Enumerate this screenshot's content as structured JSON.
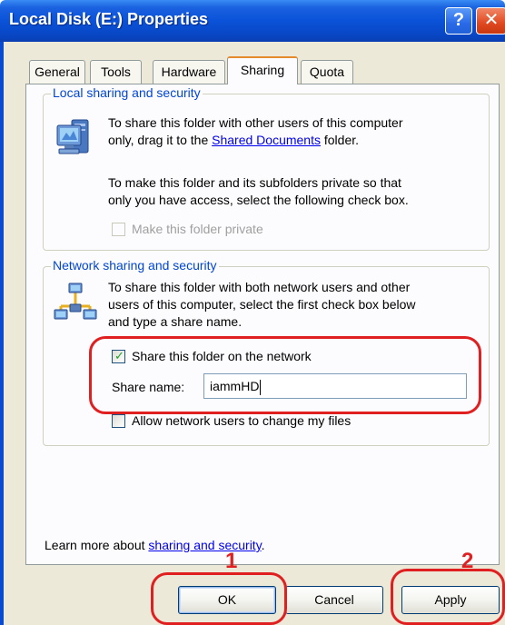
{
  "window": {
    "title": "Local Disk (E:) Properties",
    "help_label": "?",
    "close_label": "✕"
  },
  "tabs": [
    {
      "label": "General"
    },
    {
      "label": "Tools"
    },
    {
      "label": "Hardware"
    },
    {
      "label": "Sharing"
    },
    {
      "label": "Quota"
    }
  ],
  "local_sharing": {
    "group_label": "Local sharing and security",
    "line1": "To share this folder with other users of this computer",
    "line2_prefix": "only, drag it to the ",
    "line2_link": "Shared Documents",
    "line2_suffix": " folder.",
    "line3": "To make this folder and its subfolders private so that",
    "line4": "only you have access, select the following check box.",
    "private_checkbox_label": "Make this folder private"
  },
  "network_sharing": {
    "group_label": "Network sharing and security",
    "line1": "To share this folder with both network users and other",
    "line2": "users of this computer, select the first check box below",
    "line3": "and type a share name.",
    "share_checkbox_label": "Share this folder on the network",
    "share_name_label": "Share name:",
    "share_name_value": "iammHD",
    "allow_change_label": "Allow network users to change my files"
  },
  "learn_more": {
    "prefix": "Learn more about ",
    "link": "sharing and security",
    "suffix": "."
  },
  "buttons": {
    "ok": "OK",
    "cancel": "Cancel",
    "apply": "Apply"
  },
  "annotations": {
    "step1": "1",
    "step2": "2"
  },
  "colors": {
    "annotation_red": "#e02020",
    "title_blue": "#0a52d8",
    "group_label_blue": "#0046d5"
  }
}
